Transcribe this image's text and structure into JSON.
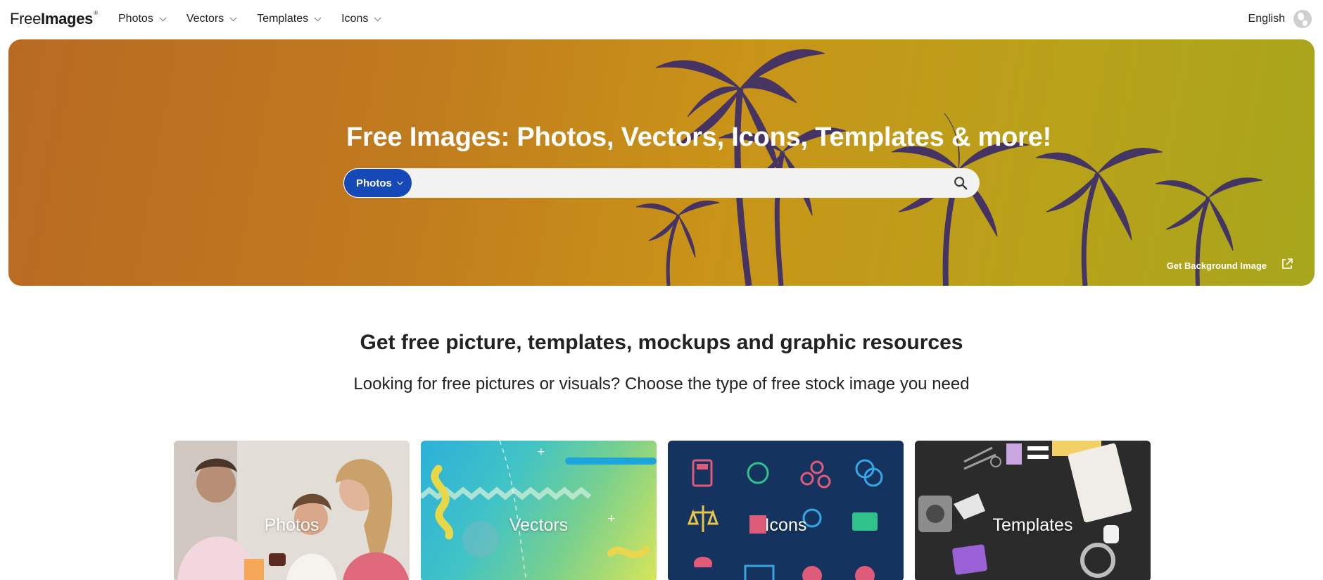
{
  "brand": {
    "logo_light": "Free",
    "logo_bold": "Images"
  },
  "nav": {
    "items": [
      {
        "label": "Photos"
      },
      {
        "label": "Vectors"
      },
      {
        "label": "Templates"
      },
      {
        "label": "Icons"
      }
    ],
    "language": "English"
  },
  "hero": {
    "title": "Free Images: Photos, Vectors, Icons, Templates & more!",
    "search": {
      "category": "Photos",
      "placeholder": "",
      "value": ""
    },
    "background_link": "Get Background Image"
  },
  "section": {
    "headline": "Get free picture, templates, mockups and graphic resources",
    "subline": "Looking for free pictures or visuals? Choose the type of free stock image you need"
  },
  "cards": [
    {
      "label": "Photos"
    },
    {
      "label": "Vectors"
    },
    {
      "label": "Icons"
    },
    {
      "label": "Templates"
    }
  ],
  "colors": {
    "primary_blue": "#1549b8",
    "hero_orange": "#b86a22",
    "hero_olive": "#a7a61c",
    "palm_purple": "#3a2d6b",
    "icons_card_bg": "#14345f"
  }
}
